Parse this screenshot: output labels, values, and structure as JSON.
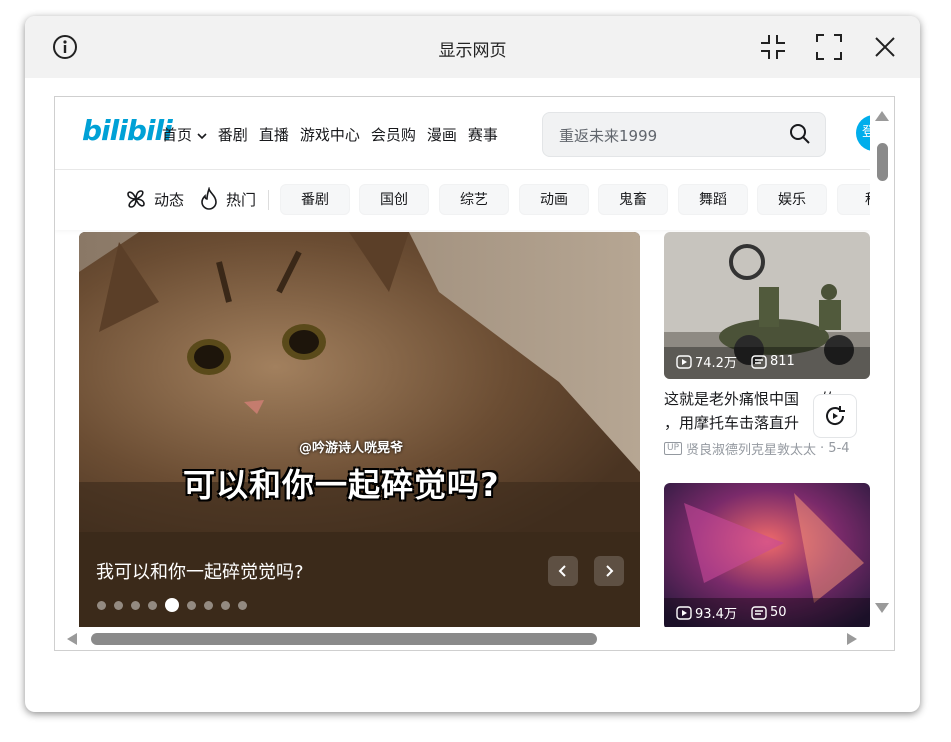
{
  "dialog": {
    "title": "显示网页",
    "icons": [
      "info-icon",
      "exit-fullscreen-icon",
      "fullscreen-icon",
      "close-icon"
    ]
  },
  "site": {
    "logo": "bilibili",
    "nav": [
      "首页",
      "番剧",
      "直播",
      "游戏中心",
      "会员购",
      "漫画",
      "赛事"
    ],
    "search_placeholder": "重返未来1999",
    "avatar_text": "登",
    "channels_fixed": [
      {
        "label": "动态",
        "icon": "pinwheel-icon"
      },
      {
        "label": "热门",
        "icon": "flame-icon"
      }
    ],
    "channels": [
      "番剧",
      "国创",
      "综艺",
      "动画",
      "鬼畜",
      "舞蹈",
      "娱乐",
      "科"
    ]
  },
  "banner": {
    "watermark": "@吟游诗人咣晃爷",
    "subtitle": "可以和你一起碎觉吗?",
    "caption": "我可以和你一起碎觉觉吗?",
    "dot_count": 9,
    "active_dot": 4
  },
  "videos": [
    {
      "views": "74.2万",
      "danmaku": "811",
      "title_line1": "这就是老外痛恨中国",
      "title_suffix": "的",
      "title_line2": "，用摩托车击落直升",
      "title_suffix2": "人",
      "author": "贤良淑德列克星敦太太",
      "date": "· 5-4"
    },
    {
      "views": "93.4万",
      "danmaku": "50"
    }
  ],
  "colors": {
    "accent": "#00a1d6",
    "avatar_bg": "#00aeec",
    "titlebar_bg": "#f2f2f2",
    "banner_bottom": "#3b2a1a"
  }
}
